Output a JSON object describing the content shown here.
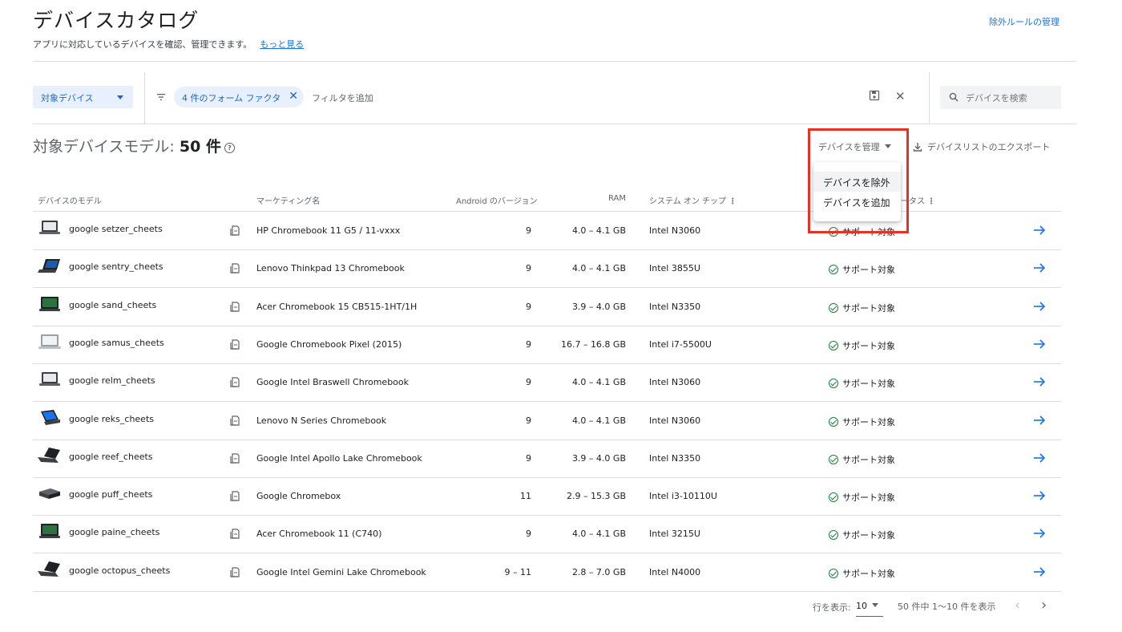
{
  "header": {
    "title": "デバイスカタログ",
    "subtitle": "アプリに対応しているデバイスを確認、管理できます。",
    "learn_more": "もっと見る",
    "exclusion_link": "除外ルールの管理"
  },
  "filterbar": {
    "ou_select": "対象デバイス",
    "chip": "4 件のフォーム ファクタ",
    "add_filter": "フィルタを追加",
    "search_placeholder": "デバイスを検索"
  },
  "summary": {
    "label": "対象デバイスモデル:",
    "count": "50 件"
  },
  "actions": {
    "manage": "デバイスを管理",
    "export": "デバイスリストのエクスポート",
    "menu": [
      "デバイスを除外",
      "デバイスを追加"
    ]
  },
  "columns": {
    "model": "デバイスのモデル",
    "marketing": "マーケティング名",
    "android": "Android のバージョン",
    "ram": "RAM",
    "soc": "システム オン チップ",
    "status_partial": "ータス"
  },
  "rows": [
    {
      "model": "google setzer_cheets",
      "marketing": "HP Chromebook 11 G5 / 11-vxxx",
      "android": "9",
      "ram": "4.0 – 4.1 GB",
      "soc": "Intel N3060",
      "status": "サポート対象",
      "thumb": "laptop-open"
    },
    {
      "model": "google sentry_cheets",
      "marketing": "Lenovo Thinkpad 13 Chromebook",
      "android": "9",
      "ram": "4.0 – 4.1 GB",
      "soc": "Intel 3855U",
      "status": "サポート対象",
      "thumb": "laptop-angled"
    },
    {
      "model": "google sand_cheets",
      "marketing": "Acer Chromebook 15 CB515-1HT/1H",
      "android": "9",
      "ram": "3.9 – 4.0 GB",
      "soc": "Intel N3350",
      "status": "サポート対象",
      "thumb": "laptop-dark"
    },
    {
      "model": "google samus_cheets",
      "marketing": "Google Chromebook Pixel (2015)",
      "android": "9",
      "ram": "16.7 – 16.8 GB",
      "soc": "Intel i7-5500U",
      "status": "サポート対象",
      "thumb": "laptop-silver"
    },
    {
      "model": "google relm_cheets",
      "marketing": "Google Intel Braswell Chromebook",
      "android": "9",
      "ram": "4.0 – 4.1 GB",
      "soc": "Intel N3060",
      "status": "サポート対象",
      "thumb": "laptop-open"
    },
    {
      "model": "google reks_cheets",
      "marketing": "Lenovo N Series Chromebook",
      "android": "9",
      "ram": "4.0 – 4.1 GB",
      "soc": "Intel N3060",
      "status": "サポート対象",
      "thumb": "laptop-blue"
    },
    {
      "model": "google reef_cheets",
      "marketing": "Google Intel Apollo Lake Chromebook",
      "android": "9",
      "ram": "3.9 – 4.0 GB",
      "soc": "Intel N3350",
      "status": "サポート対象",
      "thumb": "laptop-angled-dark"
    },
    {
      "model": "google puff_cheets",
      "marketing": "Google Chromebox",
      "android": "11",
      "ram": "2.9 – 15.3 GB",
      "soc": "Intel i3-10110U",
      "status": "サポート対象",
      "thumb": "chromebox"
    },
    {
      "model": "google paine_cheets",
      "marketing": "Acer Chromebook 11 (C740)",
      "android": "9",
      "ram": "4.0 – 4.1 GB",
      "soc": "Intel 3215U",
      "status": "サポート対象",
      "thumb": "laptop-dark"
    },
    {
      "model": "google octopus_cheets",
      "marketing": "Google Intel Gemini Lake Chromebook",
      "android": "9 – 11",
      "ram": "2.8 – 7.0 GB",
      "soc": "Intel N4000",
      "status": "サポート対象",
      "thumb": "laptop-angled-dark"
    }
  ],
  "pagination": {
    "rows_label": "行を表示:",
    "rows_value": "10",
    "range": "50 件中 1〜10 件を表示"
  },
  "colors": {
    "accent": "#1a73e8",
    "success": "#188038",
    "highlight": "#e53222"
  }
}
